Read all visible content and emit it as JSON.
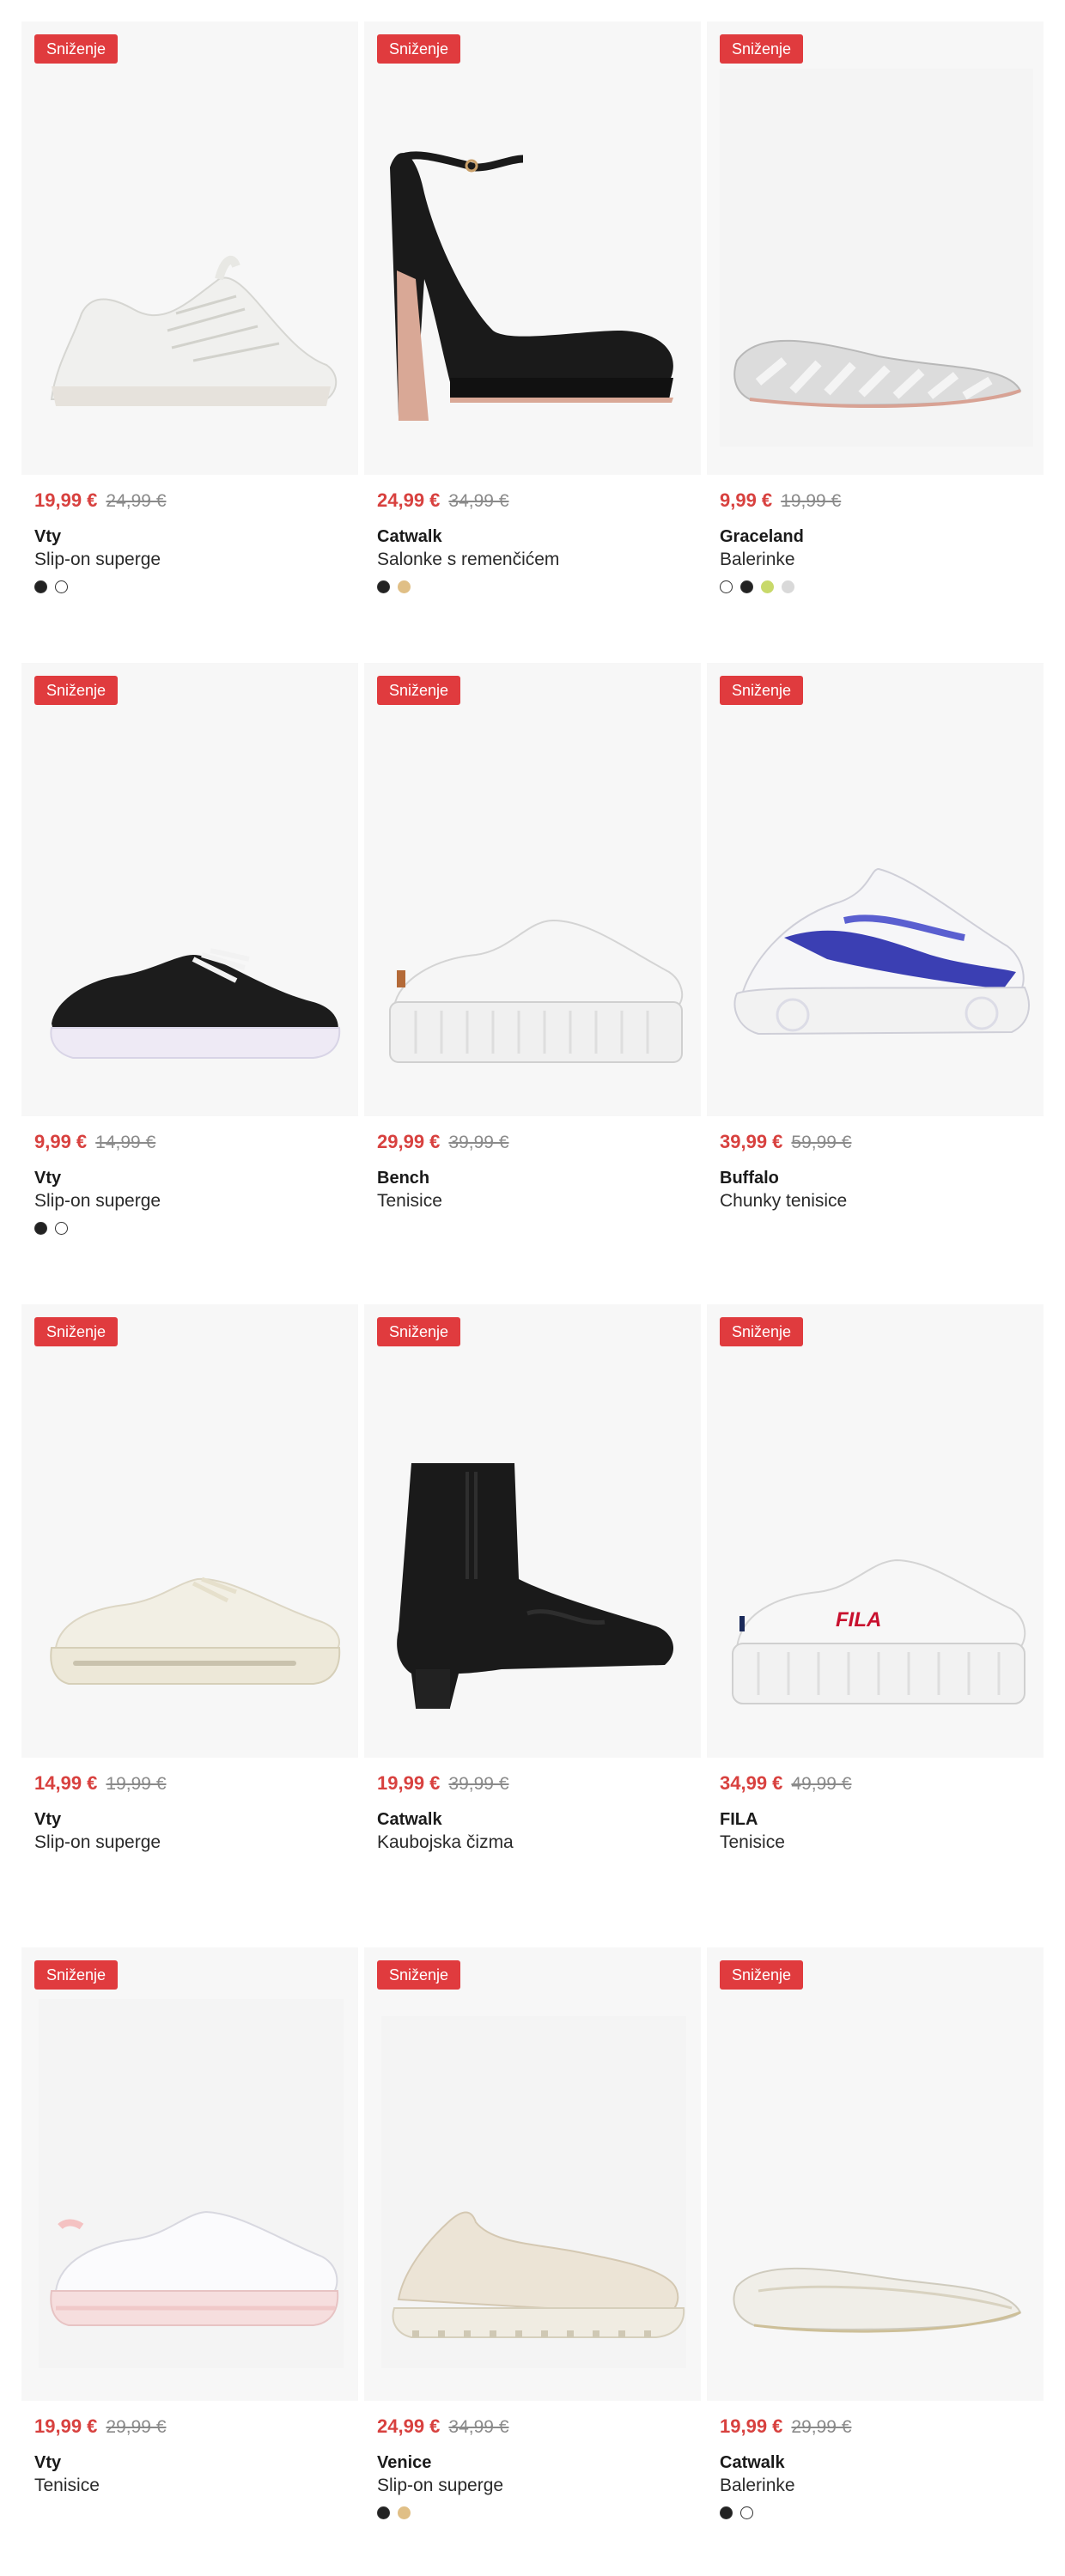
{
  "products": [
    {
      "badge": "Sniženje",
      "price_now": "19,99 €",
      "price_old": "24,99 €",
      "brand": "Vty",
      "name": "Slip-on superge",
      "swatches": [
        "#222222",
        "#ffffff"
      ],
      "image": "white-knit-sneaker"
    },
    {
      "badge": "Sniženje",
      "price_now": "24,99 €",
      "price_old": "34,99 €",
      "brand": "Catwalk",
      "name": "Salonke s remenčićem",
      "swatches": [
        "#222222",
        "#e0bf86"
      ],
      "image": "black-platform-heel"
    },
    {
      "badge": "Sniženje",
      "price_now": "9,99 €",
      "price_old": "19,99 €",
      "brand": "Graceland",
      "name": "Balerinke",
      "swatches": [
        "#ffffff",
        "#222222",
        "#c8d96a",
        "#d9d9d9"
      ],
      "image": "silver-cutout-ballerina"
    },
    {
      "badge": "Sniženje",
      "price_now": "9,99 €",
      "price_old": "14,99 €",
      "brand": "Vty",
      "name": "Slip-on superge",
      "swatches": [
        "#222222",
        "#ffffff"
      ],
      "image": "black-canvas-sneaker"
    },
    {
      "badge": "Sniženje",
      "price_now": "29,99 €",
      "price_old": "39,99 €",
      "brand": "Bench",
      "name": "Tenisice",
      "swatches": [],
      "image": "white-platform-sneaker"
    },
    {
      "badge": "Sniženje",
      "price_now": "39,99 €",
      "price_old": "59,99 €",
      "brand": "Buffalo",
      "name": "Chunky tenisice",
      "swatches": [],
      "image": "blue-chunky-sneaker"
    },
    {
      "badge": "Sniženje",
      "price_now": "14,99 €",
      "price_old": "19,99 €",
      "brand": "Vty",
      "name": "Slip-on superge",
      "swatches": [],
      "image": "cream-mesh-sneaker"
    },
    {
      "badge": "Sniženje",
      "price_now": "19,99 €",
      "price_old": "39,99 €",
      "brand": "Catwalk",
      "name": "Kaubojska čizma",
      "swatches": [],
      "image": "black-western-boot"
    },
    {
      "badge": "Sniženje",
      "price_now": "34,99 €",
      "price_old": "49,99 €",
      "brand": "FILA",
      "name": "Tenisice",
      "swatches": [],
      "image": "white-fila-sneaker"
    },
    {
      "badge": "Sniženje",
      "price_now": "19,99 €",
      "price_old": "29,99 €",
      "brand": "Vty",
      "name": "Tenisice",
      "swatches": [],
      "image": "white-pink-sneaker"
    },
    {
      "badge": "Sniženje",
      "price_now": "24,99 €",
      "price_old": "34,99 €",
      "brand": "Venice",
      "name": "Slip-on superge",
      "swatches": [
        "#222222",
        "#e0bf86"
      ],
      "image": "beige-knit-slipon"
    },
    {
      "badge": "Sniženje",
      "price_now": "19,99 €",
      "price_old": "29,99 €",
      "brand": "Catwalk",
      "name": "Balerinke",
      "swatches": [
        "#222222",
        "#ffffff"
      ],
      "image": "white-glitter-ballerina"
    }
  ],
  "fila_logo": "FILA"
}
